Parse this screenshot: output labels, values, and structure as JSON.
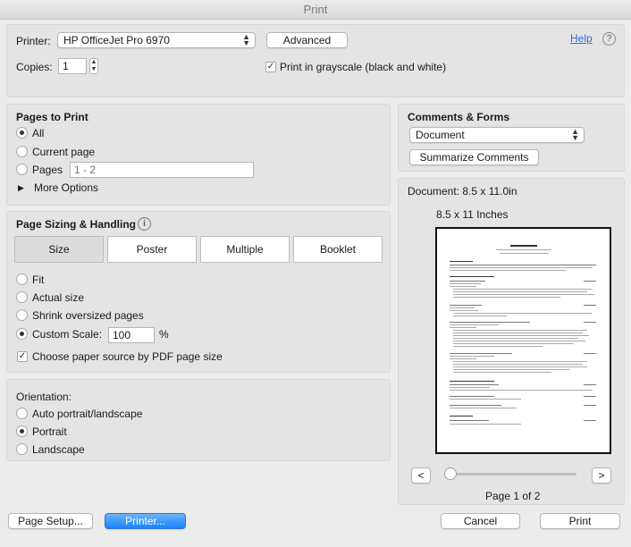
{
  "window": {
    "title": "Print"
  },
  "printer": {
    "label": "Printer:",
    "selected": "HP OfficeJet Pro 6970",
    "advanced_label": "Advanced",
    "help_label": "Help",
    "copies_label": "Copies:",
    "copies_value": "1",
    "grayscale_label": "Print in grayscale (black and white)",
    "grayscale_checked": true
  },
  "pages_to_print": {
    "heading": "Pages to Print",
    "options": [
      "All",
      "Current page",
      "Pages"
    ],
    "selected": "All",
    "pages_placeholder": "1 - 2",
    "more_options_label": "More Options"
  },
  "sizing": {
    "heading": "Page Sizing & Handling",
    "tabs": [
      "Size",
      "Poster",
      "Multiple",
      "Booklet"
    ],
    "selected_tab": "Size",
    "options": [
      "Fit",
      "Actual size",
      "Shrink oversized pages",
      "Custom Scale:"
    ],
    "selected_option": "Custom Scale:",
    "scale_value": "100",
    "scale_unit": "%",
    "paper_source_label": "Choose paper source by PDF page size",
    "paper_source_checked": true
  },
  "orientation": {
    "heading": "Orientation:",
    "options": [
      "Auto portrait/landscape",
      "Portrait",
      "Landscape"
    ],
    "selected": "Portrait"
  },
  "comments_forms": {
    "heading": "Comments & Forms",
    "selected": "Document",
    "summarize_label": "Summarize Comments"
  },
  "preview": {
    "document_label": "Document: 8.5 x 11.0in",
    "page_size_label": "8.5 x 11 Inches",
    "prev_label": "<",
    "next_label": ">",
    "page_indicator": "Page 1 of 2",
    "slider_position": 0
  },
  "footer": {
    "page_setup_label": "Page Setup...",
    "printer_label": "Printer...",
    "cancel_label": "Cancel",
    "print_label": "Print"
  }
}
